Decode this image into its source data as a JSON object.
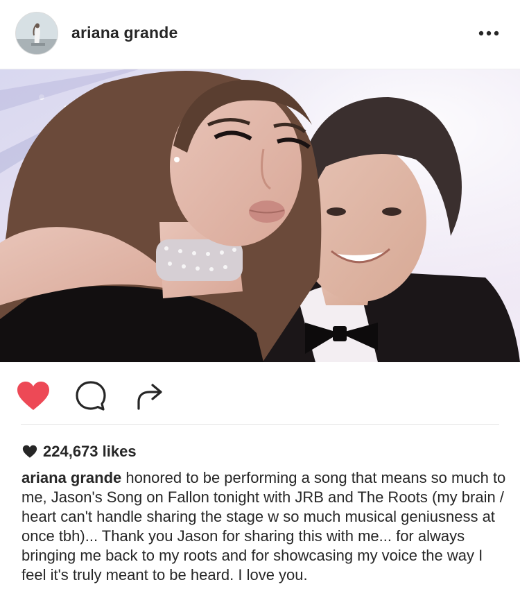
{
  "post": {
    "username": "ariana grande",
    "likes": "224,673 likes",
    "caption": "honored to be performing a song that means so much to me, Jason's Song on Fallon tonight with JRB and The Roots (my brain / heart can't handle sharing the stage w so much musical geniusness at once tbh)... Thank you Jason for sharing this with me... for always bringing me back to my roots and for showcasing my voice the way I feel it's truly meant to be heard. I love you."
  },
  "colors": {
    "like_active": "#ed4956",
    "text": "#262626"
  },
  "icons": {
    "more": "more-options-icon",
    "like": "heart-icon",
    "comment": "comment-icon",
    "share": "share-icon",
    "likes_heart": "likes-heart-icon"
  }
}
